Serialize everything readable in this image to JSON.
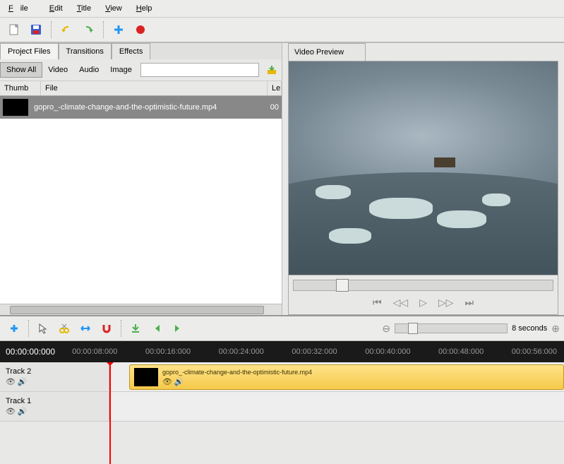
{
  "menu": {
    "file": "File",
    "edit": "Edit",
    "title": "Title",
    "view": "View",
    "help": "Help"
  },
  "panel_tabs": {
    "project_files": "Project Files",
    "transitions": "Transitions",
    "effects": "Effects"
  },
  "filters": {
    "show_all": "Show All",
    "video": "Video",
    "audio": "Audio",
    "image": "Image"
  },
  "list_headers": {
    "thumb": "Thumb",
    "file": "File",
    "length": "Le"
  },
  "file": {
    "name": "gopro_-climate-change-and-the-optimistic-future.mp4",
    "length_preview": "00"
  },
  "preview": {
    "header": "Video Preview"
  },
  "timeline": {
    "current": "00:00:00:000",
    "zoom_label": "8 seconds",
    "ticks": [
      "00:00:08:000",
      "00:00:16:000",
      "00:00:24:000",
      "00:00:32:000",
      "00:00:40:000",
      "00:00:48:000",
      "00:00:56:000"
    ]
  },
  "tracks": {
    "t2": {
      "name": "Track 2"
    },
    "t1": {
      "name": "Track 1"
    }
  },
  "clip": {
    "label": "gopro_-climate-change-and-the-optimistic-future.mp4"
  }
}
